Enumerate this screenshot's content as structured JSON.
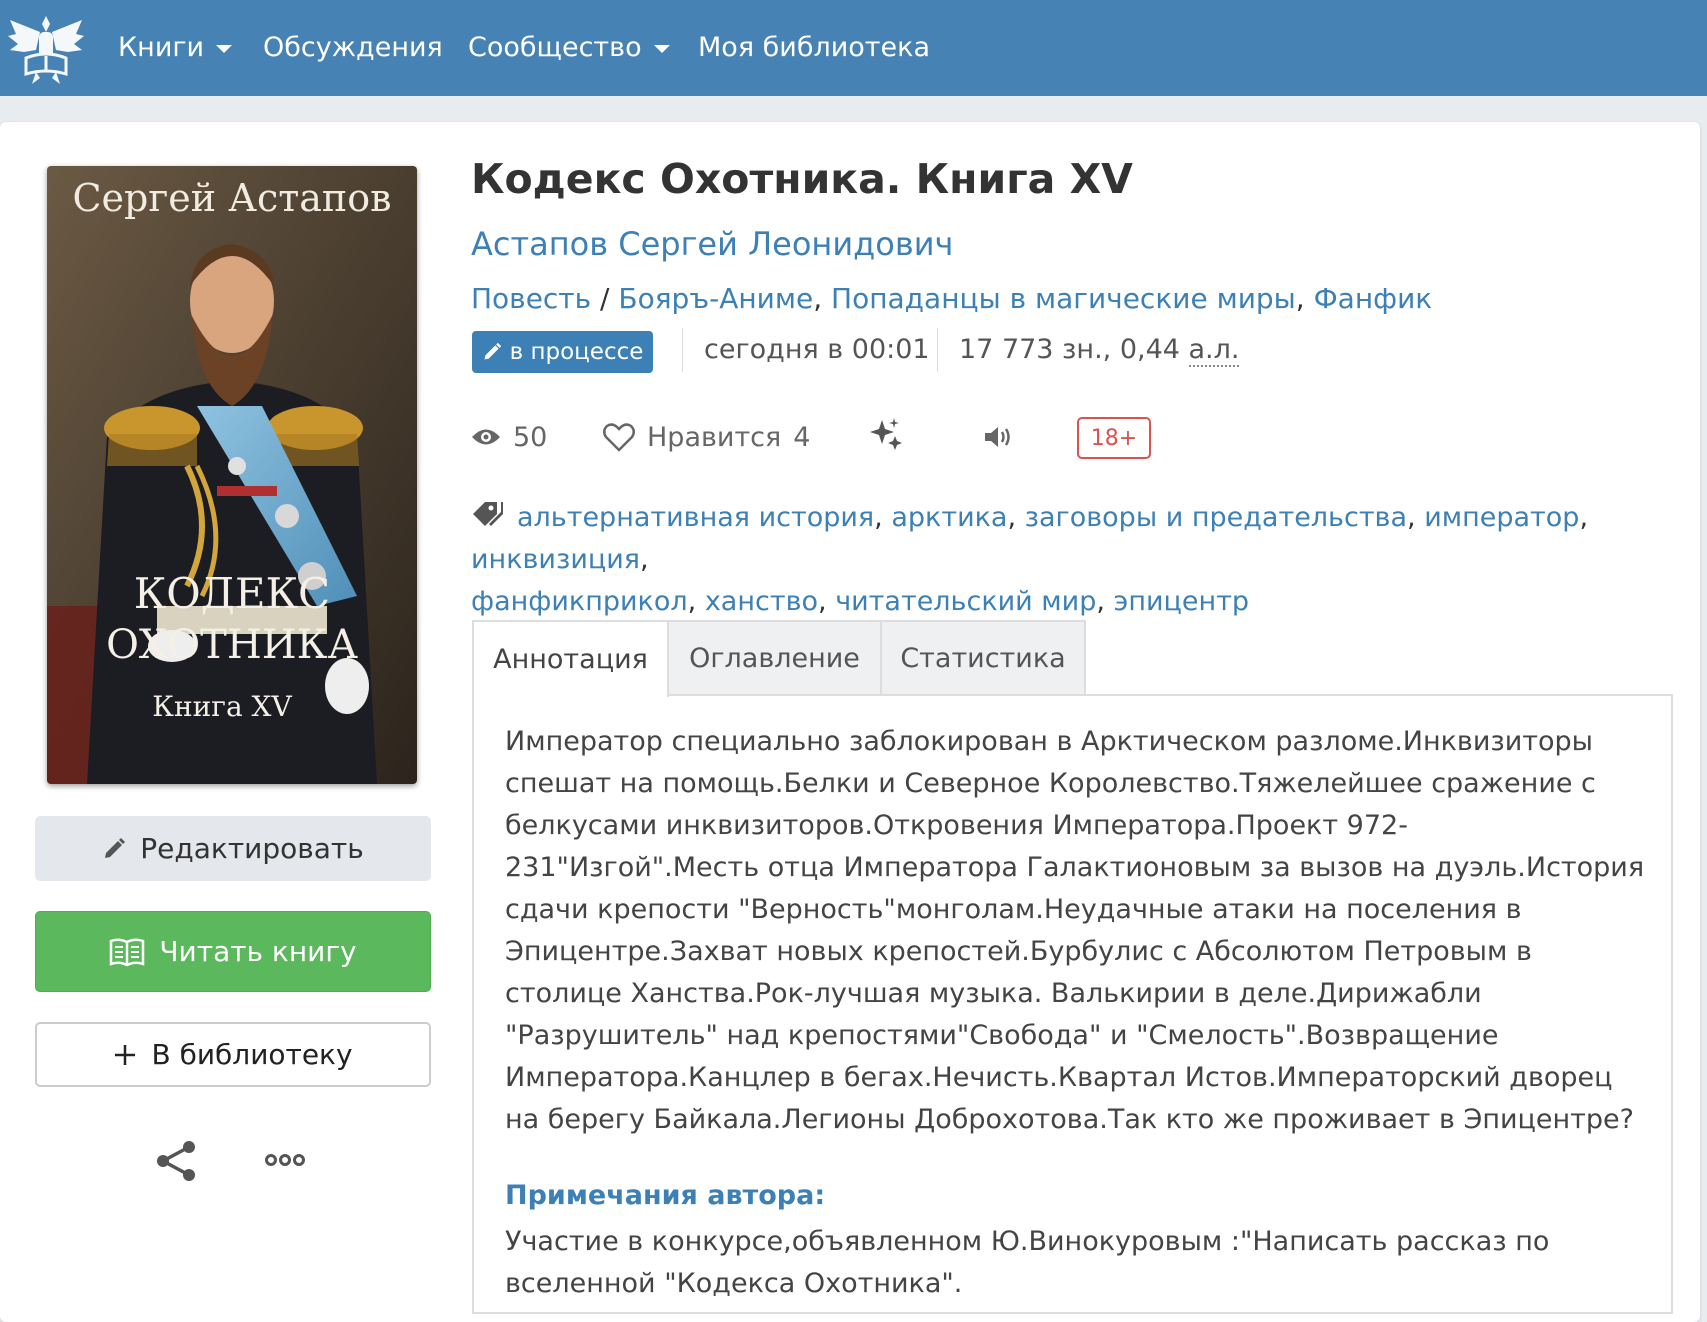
{
  "nav": {
    "items": [
      {
        "label": "Книги",
        "dropdown": true
      },
      {
        "label": "Обсуждения",
        "dropdown": false
      },
      {
        "label": "Сообщество",
        "dropdown": true
      },
      {
        "label": "Моя библиотека",
        "dropdown": false
      }
    ]
  },
  "cover": {
    "author_line": "Сергей  Астапов",
    "title_line1": "КОДЕКС",
    "title_line2": "ОХОТНИКА",
    "book_line": "Книга XV"
  },
  "actions": {
    "edit_label": "Редактировать",
    "read_label": "Читать книгу",
    "library_label": "В библиотеку",
    "share_icon": "share-icon",
    "more_icon": "more-icon"
  },
  "book": {
    "title": "Кодекс Охотника. Книга XV",
    "author": "Астапов Сергей Леонидович",
    "form": "Повесть",
    "genres_separator": " / ",
    "genres": [
      "Бояръ-Аниме",
      "Попаданцы в магические миры",
      "Фанфик"
    ],
    "status": "в процессе",
    "updated": "сегодня в 00:01",
    "size_chars": "17 773 зн., 0,44 ",
    "size_unit": "а.л.",
    "views": "50",
    "likes_label": "Нравится",
    "likes": "4",
    "age_rating": "18+"
  },
  "tags": [
    "альтернативная история",
    "арктика",
    "заговоры и предательства",
    "император",
    "инквизиция",
    "фанфикприкол",
    "ханство",
    "читательский мир",
    "эпицентр"
  ],
  "tabs": [
    {
      "label": "Аннотация",
      "active": true
    },
    {
      "label": "Оглавление",
      "active": false
    },
    {
      "label": "Статистика",
      "active": false
    }
  ],
  "annotation": "Император специально заблокирован в Арктическом разломе.Инквизиторы спешат на помощь.Белки и Северное Королевство.Тяжелейшее сражение с белкусами инквизиторов.Откровения Императора.Проект 972-231\"Изгой\".Месть отца Императора Галактионовым за вызов на дуэль.История сдачи крепости \"Верность\"монголам.Неудачные атаки на поселения в Эпицентре.Захват новых крепостей.Бурбулис с Абсолютом Петровым в столице Ханства.Рок-лучшая музыка. Валькирии в деле.Дирижабли \"Разрушитель\" над крепостями\"Свобода\" и \"Смелость\".Возвращение Императора.Канцлер в бегах.Нечисть.Квартал Истов.Императорский дворец на берегу Байкала.Легионы Доброхотова.Так кто же проживает в Эпицентре?",
  "notes": {
    "title": "Примечания автора:",
    "text": "Участие в конкурсе,объявленном Ю.Винокуровым :\"Написать рассказ по вселенной \"Кодекса Охотника\"."
  },
  "colors": {
    "navbar": "#4682b4",
    "link": "#3d80b5",
    "read_button": "#5cb85c",
    "age_badge": "#d9534f"
  }
}
